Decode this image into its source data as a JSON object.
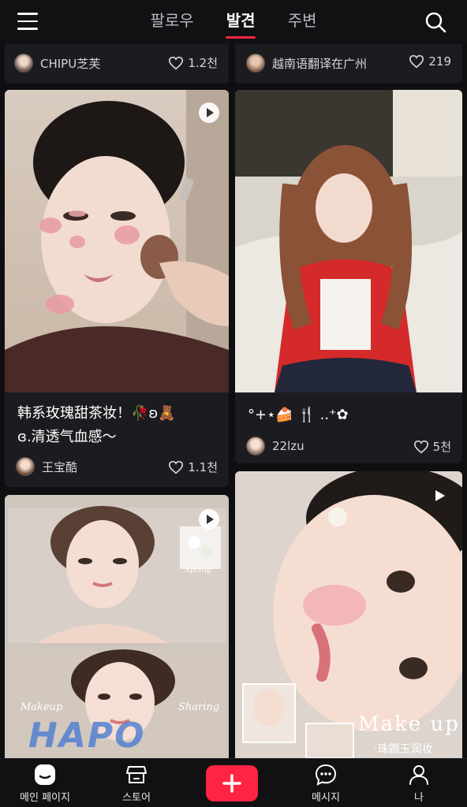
{
  "header": {
    "tabs": [
      {
        "label": "팔로우",
        "active": false
      },
      {
        "label": "발견",
        "active": true
      },
      {
        "label": "주변",
        "active": false
      }
    ]
  },
  "feed": {
    "top_row": [
      {
        "author": "CHIPU芝芙",
        "likes": "1.2천"
      },
      {
        "author": "越南语翻译在广州",
        "likes": "219"
      }
    ],
    "cards": [
      {
        "title_line1": "韩系玫瑰甜茶妆！🥀ʚ🧸",
        "title_line2": "ɞ.清透气血感～",
        "author": "王宝酷",
        "likes": "1.1천",
        "is_video": true
      },
      {
        "title_line1": "°+⋆🍰 🍴 ..⁺✿",
        "author": "22lzu",
        "likes": "5천",
        "is_video": false
      },
      {
        "overlay_left": "Makeup",
        "overlay_right": "Sharing",
        "overlay_small": "Spring",
        "overlay_brand": "HAPO",
        "is_video": true
      },
      {
        "overlay_title": "Make up",
        "overlay_sub": "·珠圆玉润妆",
        "is_video": true
      }
    ]
  },
  "bottom_nav": {
    "home": "메인 페이지",
    "store": "스토어",
    "messages": "메시지",
    "me": "나"
  },
  "colors": {
    "accent": "#ff2442",
    "background": "#0f0f12",
    "card": "#1c1c20"
  }
}
